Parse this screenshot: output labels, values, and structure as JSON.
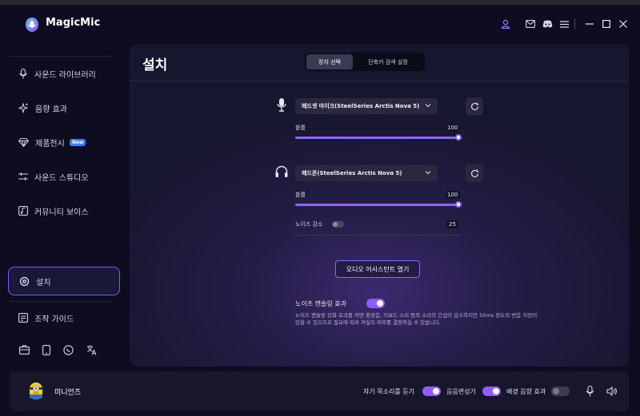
{
  "app": {
    "title": "MagicMic"
  },
  "sidebar": {
    "items": [
      {
        "label": "사운드 라이브러리",
        "icon": "mic-icon"
      },
      {
        "label": "음향 효과",
        "icon": "sparkle-icon"
      },
      {
        "label": "제품전시",
        "icon": "diamond-icon",
        "badge": "New"
      },
      {
        "label": "사운드 스튜디오",
        "icon": "sliders-icon"
      },
      {
        "label": "커뮤니티 보이스",
        "icon": "music-note-icon"
      },
      {
        "label": "설치",
        "icon": "gear-icon",
        "active": true
      },
      {
        "label": "조작 가이드",
        "icon": "guide-icon"
      }
    ]
  },
  "main": {
    "title": "설치",
    "tabs": [
      {
        "label": "장치 선택",
        "active": true
      },
      {
        "label": "단축키 검색 설정",
        "active": false
      }
    ],
    "mic": {
      "device": "헤드셋 마이크(SteelSeries Arctis Nova 5)",
      "volume_label": "볼륨",
      "volume_value": "100"
    },
    "headphone": {
      "device": "헤드폰(SteelSeries Arctis Nova 5)",
      "volume_label": "볼륨",
      "volume_value": "100",
      "noise_label": "노이즈 감소",
      "noise_value": "25"
    },
    "assistant_button": "오디오 어시스턴트 열기",
    "noise_cancel": {
      "title": "노이즈 캔슬링 효과",
      "description": "노이즈 캔슬링 강화 효과를 켜면 환경음, 키보드 소리 등의 소리의 간섭이 감소하지만 50ms 정도의 변음 지연이 있을 수 있으므로 필요에 따라 켜실지 여부를 결정하실 수 있습니다."
    }
  },
  "bottombar": {
    "username": "미니언즈",
    "hear_myself": "자기 목소리를 듣기",
    "voice_changer": "음음변성기",
    "bg_effect": "배경 음향 효과"
  },
  "colors": {
    "accent": "#8e66ff",
    "background": "#0d0c20",
    "badge": "#3d7bff"
  }
}
